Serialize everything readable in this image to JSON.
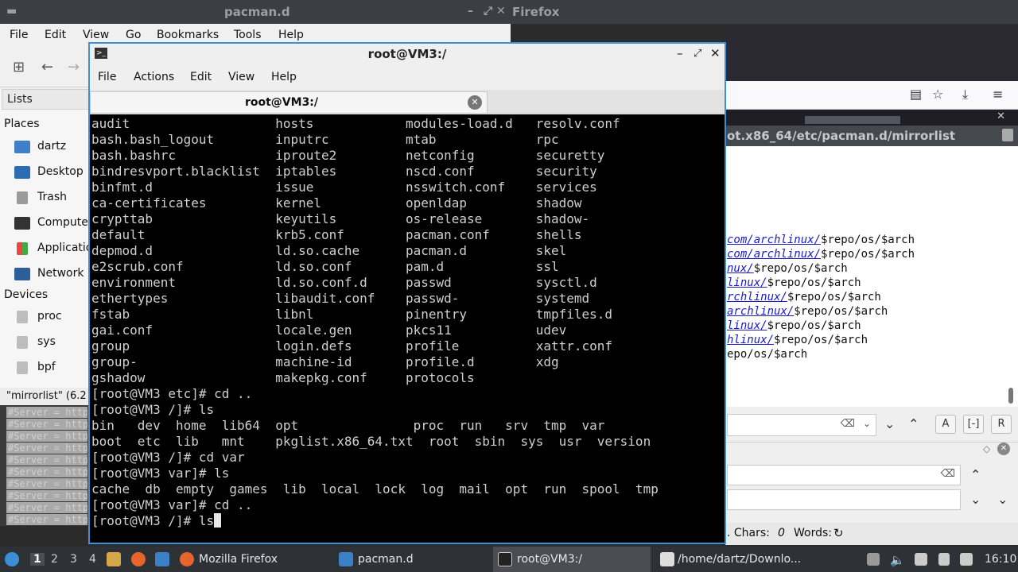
{
  "bg_windows": {
    "pacman_title": "pacman.d",
    "firefox_title": "Firefox"
  },
  "file_manager": {
    "menu": [
      "File",
      "Edit",
      "View",
      "Go",
      "Bookmarks",
      "Tools",
      "Help"
    ],
    "lists_label": "Lists",
    "places_header": "Places",
    "places": [
      {
        "label": "dartz",
        "icon": "folder-icon"
      },
      {
        "label": "Desktop",
        "icon": "desktop-icon"
      },
      {
        "label": "Trash",
        "icon": "trash-icon"
      },
      {
        "label": "Computer",
        "icon": "computer-icon"
      },
      {
        "label": "Applications",
        "icon": "applications-icon"
      },
      {
        "label": "Network",
        "icon": "network-icon"
      }
    ],
    "devices_header": "Devices",
    "devices": [
      {
        "label": "proc",
        "icon": "drive-icon"
      },
      {
        "label": "sys",
        "icon": "drive-icon"
      },
      {
        "label": "bpf",
        "icon": "drive-icon"
      }
    ],
    "status": "\"mirrorlist\" (6.2"
  },
  "mirror_fragment": [
    "#Server = http",
    "#Server = http",
    "#Server = http",
    "#Server = http",
    "#Server = http",
    "#Server = http",
    "#Server = http",
    "#Server = http",
    "#Server = http",
    "#Server = http"
  ],
  "editor": {
    "title": "ot.x86_64/etc/pacman.d/mirrorlist",
    "lines": [
      {
        "url": "com/archlinux/",
        "rest": "$repo/os/$arch"
      },
      {
        "url": "com/archlinux/",
        "rest": "$repo/os/$arch"
      },
      {
        "url": "nux/",
        "rest": "$repo/os/$arch"
      },
      {
        "url": "linux/",
        "rest": "$repo/os/$arch"
      },
      {
        "url": "rchlinux/",
        "rest": "$repo/os/$arch"
      },
      {
        "url": "archlinux/",
        "rest": "$repo/os/$arch"
      },
      {
        "url": "linux/",
        "rest": "$repo/os/$arch"
      },
      {
        "url": "hlinux/",
        "rest": "$repo/os/$arch"
      },
      {
        "url": "",
        "rest": "epo/os/$arch"
      }
    ],
    "find_buttons": [
      "A",
      "[-]",
      "R"
    ],
    "counts_label": ". Chars:",
    "chars_value": "0",
    "words_label": "Words:"
  },
  "terminal": {
    "title": "root@VM3:/",
    "menu": [
      "File",
      "Actions",
      "Edit",
      "View",
      "Help"
    ],
    "tab_label": "root@VM3:/",
    "lines": [
      "audit                   hosts            modules-load.d   resolv.conf",
      "bash.bash_logout        inputrc          mtab             rpc",
      "bash.bashrc             iproute2         netconfig        securetty",
      "bindresvport.blacklist  iptables         nscd.conf        security",
      "binfmt.d                issue            nsswitch.conf    services",
      "ca-certificates         kernel           openldap         shadow",
      "crypttab                keyutils         os-release       shadow-",
      "default                 krb5.conf        pacman.conf      shells",
      "depmod.d                ld.so.cache      pacman.d         skel",
      "e2scrub.conf            ld.so.conf       pam.d            ssl",
      "environment             ld.so.conf.d     passwd           sysctl.d",
      "ethertypes              libaudit.conf    passwd-          systemd",
      "fstab                   libnl            pinentry         tmpfiles.d",
      "gai.conf                locale.gen       pkcs11           udev",
      "group                   login.defs       profile          xattr.conf",
      "group-                  machine-id       profile.d        xdg",
      "gshadow                 makepkg.conf     protocols",
      "[root@VM3 etc]# cd ..",
      "[root@VM3 /]# ls",
      "bin   dev  home  lib64  opt               proc  run   srv  tmp  var",
      "boot  etc  lib   mnt    pkglist.x86_64.txt  root  sbin  sys  usr  version",
      "[root@VM3 /]# cd var",
      "[root@VM3 var]# ls",
      "cache  db  empty  games  lib  local  lock  log  mail  opt  run  spool  tmp",
      "[root@VM3 var]# cd ..",
      "[root@VM3 /]# ls"
    ]
  },
  "taskbar": {
    "workspaces": [
      "1",
      "2",
      "3",
      "4"
    ],
    "tasks": [
      {
        "label": "Mozilla Firefox",
        "icon": "firefox-icon"
      },
      {
        "label": "pacman.d",
        "icon": "folder-icon"
      },
      {
        "label": "root@VM3:/",
        "icon": "terminal-icon"
      },
      {
        "label": "/home/dartz/Downlo...",
        "icon": "text-editor-icon"
      }
    ],
    "clock": "16:10"
  },
  "colors": {
    "terminal_border": "#3d8fd8",
    "link": "#1a1ac8"
  }
}
